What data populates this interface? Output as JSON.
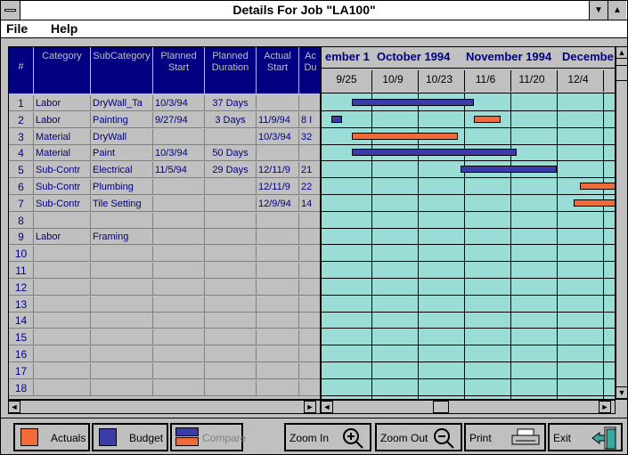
{
  "window": {
    "title": "Details For Job \"LA100\""
  },
  "menu": [
    "File",
    "Help"
  ],
  "grid": {
    "headers": [
      "#",
      "Category",
      "SubCategory",
      "Planned Start",
      "Planned Duration",
      "Actual Start",
      "Ac Du"
    ],
    "rows": [
      [
        "1",
        "Labor",
        "DryWall_Ta",
        "10/3/94",
        "37 Days",
        "",
        ""
      ],
      [
        "2",
        "Labor",
        "Painting",
        "9/27/94",
        "3 Days",
        "11/9/94",
        "8 I"
      ],
      [
        "3",
        "Material",
        "DryWall",
        "",
        "",
        "10/3/94",
        "32"
      ],
      [
        "4",
        "Material",
        "Paint",
        "10/3/94",
        "50 Days",
        "",
        ""
      ],
      [
        "5",
        "Sub-Contr",
        "Electrical",
        "11/5/94",
        "29 Days",
        "12/11/9",
        "21"
      ],
      [
        "6",
        "Sub-Contr",
        "Plumbing",
        "",
        "",
        "12/11/9",
        "22"
      ],
      [
        "7",
        "Sub-Contr",
        "Tile Setting",
        "",
        "",
        "12/9/94",
        "14"
      ],
      [
        "8",
        "",
        "",
        "",
        "",
        "",
        ""
      ],
      [
        "9",
        "Labor",
        "Framing",
        "",
        "",
        "",
        ""
      ],
      [
        "10",
        "",
        "",
        "",
        "",
        "",
        ""
      ],
      [
        "11",
        "",
        "",
        "",
        "",
        "",
        ""
      ],
      [
        "12",
        "",
        "",
        "",
        "",
        "",
        ""
      ],
      [
        "13",
        "",
        "",
        "",
        "",
        "",
        ""
      ],
      [
        "14",
        "",
        "",
        "",
        "",
        "",
        ""
      ],
      [
        "15",
        "",
        "",
        "",
        "",
        "",
        ""
      ],
      [
        "16",
        "",
        "",
        "",
        "",
        "",
        ""
      ],
      [
        "17",
        "",
        "",
        "",
        "",
        "",
        ""
      ],
      [
        "18",
        "",
        "",
        "",
        "",
        "",
        ""
      ]
    ]
  },
  "gantt": {
    "months": [
      "ember 1",
      "October 1994",
      "November 1994",
      "Decembe"
    ],
    "weeks": [
      "9/25",
      "10/9",
      "10/23",
      "11/6",
      "11/20",
      "12/4"
    ],
    "bars": [
      {
        "row": 1,
        "type": "budget",
        "start": "10/3/94",
        "days": 37
      },
      {
        "row": 2,
        "type": "budget",
        "start": "9/27/94",
        "days": 3
      },
      {
        "row": 2,
        "type": "actual",
        "start": "11/9/94",
        "days": 8
      },
      {
        "row": 3,
        "type": "actual",
        "start": "10/3/94",
        "days": 32
      },
      {
        "row": 4,
        "type": "budget",
        "start": "10/3/94",
        "days": 50
      },
      {
        "row": 5,
        "type": "budget",
        "start": "11/5/94",
        "days": 29
      },
      {
        "row": 6,
        "type": "actual",
        "start": "12/11/94",
        "days": 22
      },
      {
        "row": 7,
        "type": "actual",
        "start": "12/9/94",
        "days": 14
      }
    ]
  },
  "toolbar": {
    "actuals": "Actuals",
    "budget": "Budget",
    "compare": "Compare",
    "zoom_in": "Zoom In",
    "zoom_out": "Zoom Out",
    "print": "Print",
    "exit": "Exit"
  },
  "colors": {
    "actual": "#f06a3a",
    "budget": "#3b3ba8",
    "grid_bg": "#9adcd6",
    "header": "#000080"
  }
}
